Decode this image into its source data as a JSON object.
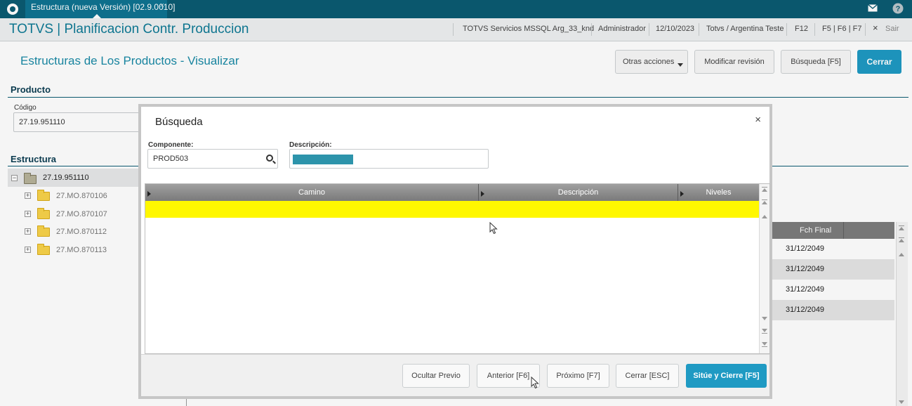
{
  "topbar": {
    "tab_label": "Estructura (nueva Versión) [02.9.0010]",
    "tab_close": "×",
    "mail_icon": "mail-icon",
    "help_icon": "help-icon"
  },
  "header": {
    "app_title": "TOTVS | Planificacion Contr. Produccion",
    "server": "TOTVS Servicios MSSQL Arg_33_knd",
    "user": "Administrador",
    "date": "12/10/2023",
    "company": "Totvs / Argentina Teste",
    "f12": "F12",
    "fkeys": "F5 | F6 | F7",
    "exit_label": "Sair",
    "exit_icon": "×"
  },
  "page": {
    "title": "Estructuras de Los Productos - Visualizar",
    "buttons": {
      "otras": "Otras acciones",
      "modificar": "Modificar revisión",
      "busqueda": "Búsqueda [F5]",
      "cerrar": "Cerrar"
    }
  },
  "producto": {
    "section_title": "Producto",
    "codigo_label": "Código",
    "codigo_value": "27.19.951110"
  },
  "estructura": {
    "section_title": "Estructura",
    "root": "27.19.951110",
    "children": [
      "27.MO.870106",
      "27.MO.870107",
      "27.MO.870112",
      "27.MO.870113"
    ]
  },
  "background_grid": {
    "header": "Fch Final",
    "rows": [
      "31/12/2049",
      "31/12/2049",
      "31/12/2049",
      "31/12/2049"
    ]
  },
  "dialog": {
    "title": "Búsqueda",
    "close": "×",
    "componente_label": "Componente:",
    "componente_value": "PROD503",
    "descripcion_label": "Descripción:",
    "columns": [
      "Camino",
      "Descripción",
      "Niveles"
    ],
    "footer_buttons": {
      "ocultar": "Ocultar Previo",
      "anterior": "Anterior [F6]",
      "proximo": "Próximo [F7]",
      "cerrar": "Cerrar [ESC]",
      "situe": "Sitúe y Cierre [F5]"
    }
  },
  "colors": {
    "topbar": "#0b5b72",
    "accent": "#1f9ac3",
    "highlight_row": "#fff700"
  }
}
